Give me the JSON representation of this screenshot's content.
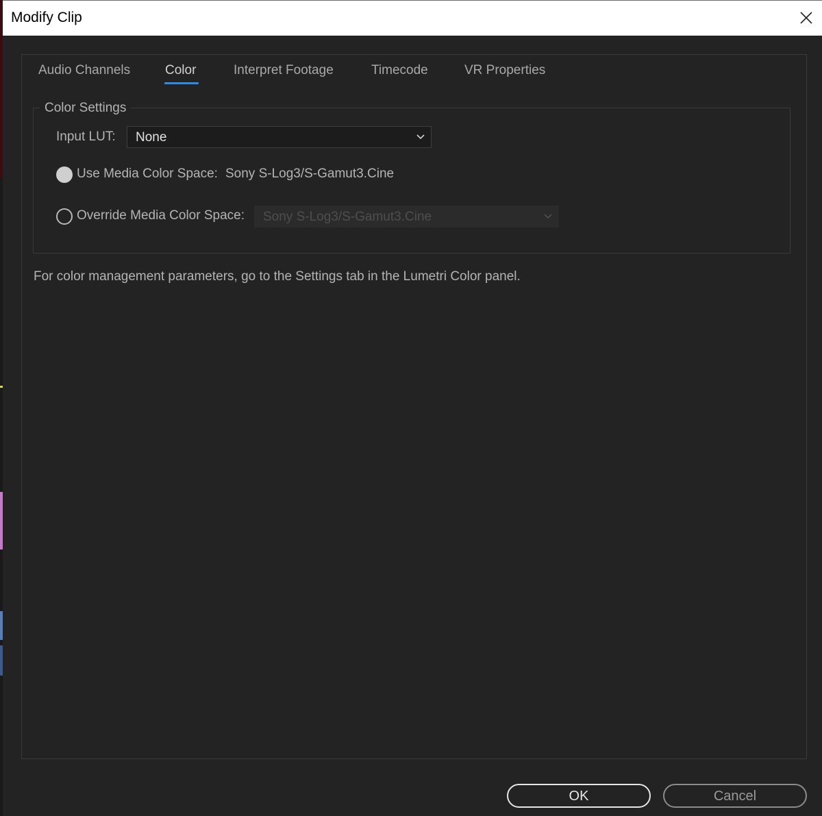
{
  "window": {
    "title": "Modify Clip"
  },
  "tabs": [
    {
      "label": "Audio Channels"
    },
    {
      "label": "Color"
    },
    {
      "label": "Interpret Footage"
    },
    {
      "label": "Timecode"
    },
    {
      "label": "VR Properties"
    }
  ],
  "active_tab": "Color",
  "color_settings": {
    "group_title": "Color Settings",
    "input_lut_label": "Input LUT:",
    "input_lut_value": "None",
    "use_media_label": "Use Media Color Space:",
    "use_media_value": "Sony S-Log3/S-Gamut3.Cine",
    "override_label": "Override Media Color Space:",
    "override_value": "Sony S-Log3/S-Gamut3.Cine",
    "selected_option": "Use Media Color Space"
  },
  "info_text": "For color management parameters, go to the Settings tab in the Lumetri Color panel.",
  "buttons": {
    "ok": "OK",
    "cancel": "Cancel"
  },
  "colors": {
    "background": "#232323",
    "accent": "#2d8ceb",
    "titlebar": "#ffffff"
  }
}
